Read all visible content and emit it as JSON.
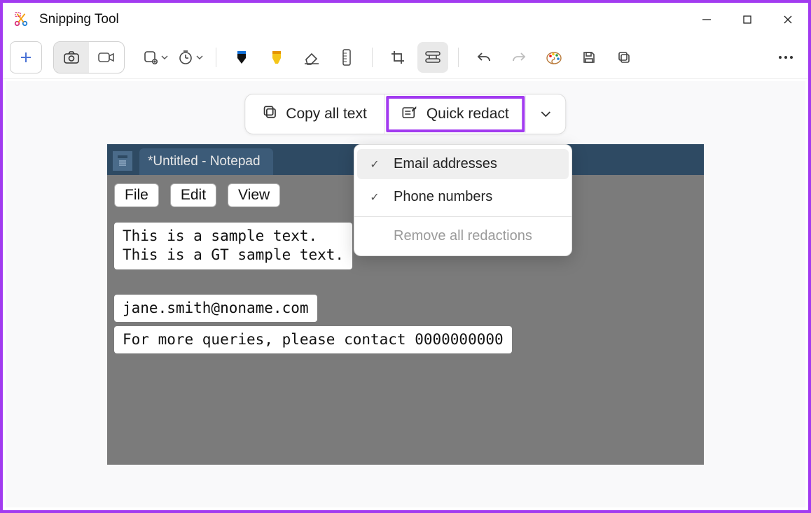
{
  "window": {
    "title": "Snipping Tool"
  },
  "actionbar": {
    "copy_all": "Copy all text",
    "quick_redact": "Quick redact"
  },
  "redact_menu": {
    "email": "Email addresses",
    "phone": "Phone numbers",
    "remove": "Remove all redactions"
  },
  "notepad": {
    "tab": "*Untitled - Notepad",
    "menus": {
      "file": "File",
      "edit": "Edit",
      "view": "View"
    },
    "block1": "This is a sample text.\nThis is a GT sample text.",
    "block2": "jane.smith@noname.com",
    "block3": "For more queries, please contact 0000000000"
  }
}
